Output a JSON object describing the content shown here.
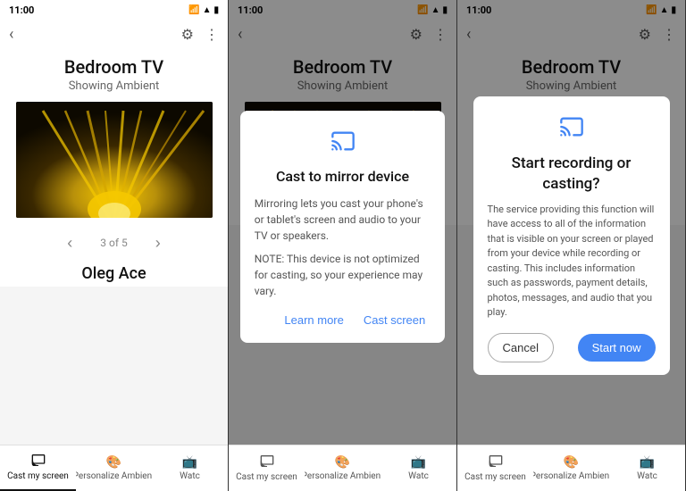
{
  "panels": [
    {
      "id": "panel1",
      "status_time": "11:00",
      "title": "Bedroom TV",
      "subtitle": "Showing Ambient",
      "counter": "3 of 5",
      "artist": "Oleg Ace",
      "tabs": [
        {
          "label": "Cast my screen",
          "icon": "cast",
          "active": true
        },
        {
          "label": "Personalize Ambient",
          "icon": "palette",
          "active": false
        },
        {
          "label": "Watc",
          "icon": "tv",
          "active": false
        }
      ]
    },
    {
      "id": "panel2",
      "status_time": "11:00",
      "title": "Bedroom TV",
      "subtitle": "Showing Ambient",
      "dialog": {
        "type": "cast_to_mirror",
        "icon": "cast",
        "title": "Cast to mirror device",
        "body": "Mirroring lets you cast your phone's or tablet's screen and audio to your TV or speakers.",
        "note": "NOTE: This device is not optimized for casting, so your experience may vary.",
        "actions": [
          {
            "label": "Learn more",
            "type": "text"
          },
          {
            "label": "Cast screen",
            "type": "text"
          }
        ]
      },
      "tabs": [
        {
          "label": "Cast my screen",
          "icon": "cast",
          "active": false
        },
        {
          "label": "Personalize Ambient",
          "icon": "palette",
          "active": false
        },
        {
          "label": "Watc",
          "icon": "tv",
          "active": false
        }
      ]
    },
    {
      "id": "panel3",
      "status_time": "11:00",
      "title": "Bedroom TV",
      "subtitle": "Showing Ambient",
      "dialog": {
        "type": "start_recording",
        "icon": "cast",
        "title": "Start recording or casting?",
        "body": "The service providing this function will have access to all of the information that is visible on your screen or played from your device while recording or casting. This includes information such as passwords, payment details, photos, messages, and audio that you play.",
        "actions": [
          {
            "label": "Cancel",
            "type": "cancel"
          },
          {
            "label": "Start now",
            "type": "primary"
          }
        ]
      },
      "tabs": [
        {
          "label": "Cast my screen",
          "icon": "cast",
          "active": false
        },
        {
          "label": "Personalize Ambient",
          "icon": "palette",
          "active": false
        },
        {
          "label": "Watc",
          "icon": "tv",
          "active": false
        }
      ]
    }
  ],
  "icons": {
    "cast": "⊡",
    "chevron_down": "‹",
    "chevron_right": "›",
    "gear": "⚙",
    "dots": "⋮",
    "wifi": "▲",
    "battery": "▮"
  }
}
